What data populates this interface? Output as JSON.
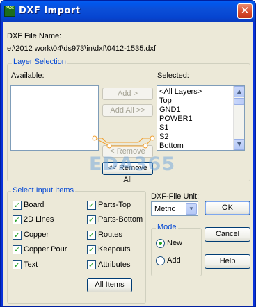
{
  "window": {
    "title": "DXF Import",
    "icon_text": "PADS",
    "close_glyph": "✕"
  },
  "file": {
    "label": "DXF File Name:",
    "path": "e:\\2012 work\\04\\ds973\\in\\dxf\\0412-1535.dxf"
  },
  "layer_selection": {
    "title": "Layer Selection",
    "available_label": "Available:",
    "selected_label": "Selected:",
    "available_items": [],
    "selected_items": [
      "<All Layers>",
      "Top",
      "GND1",
      "POWER1",
      "S1",
      "S2",
      "Bottom"
    ],
    "add_label": "Add >",
    "add_all_label": "Add All >>",
    "remove_label": "< Remove",
    "remove_all_label": "<< Remove All"
  },
  "input_items": {
    "title": "Select Input Items",
    "items": [
      {
        "label": "Board",
        "checked": true
      },
      {
        "label": "Parts-Top",
        "checked": true
      },
      {
        "label": "2D Lines",
        "checked": true
      },
      {
        "label": "Parts-Bottom",
        "checked": true
      },
      {
        "label": "Copper",
        "checked": true
      },
      {
        "label": "Routes",
        "checked": true
      },
      {
        "label": "Copper Pour",
        "checked": true
      },
      {
        "label": "Keepouts",
        "checked": true
      },
      {
        "label": "Text",
        "checked": true
      },
      {
        "label": "Attributes",
        "checked": true
      }
    ],
    "all_items_label": "All Items",
    "check_glyph": "✓"
  },
  "unit": {
    "label": "DXF-File Unit:",
    "value": "Metric"
  },
  "mode": {
    "title": "Mode",
    "options": [
      {
        "label": "New",
        "selected": true
      },
      {
        "label": "Add",
        "selected": false
      }
    ]
  },
  "actions": {
    "ok_label": "OK",
    "cancel_label": "Cancel",
    "help_label": "Help"
  },
  "watermark": {
    "text": "EDA365"
  },
  "icons": {
    "scroll_up": "▲",
    "scroll_down": "▼",
    "combo_arrow": "▼"
  },
  "colors": {
    "titlebar": "#0058ee",
    "group_title": "#0046d5",
    "check": "#21a121",
    "dialog_bg": "#ece9d8",
    "annotation": "#f0a030"
  }
}
